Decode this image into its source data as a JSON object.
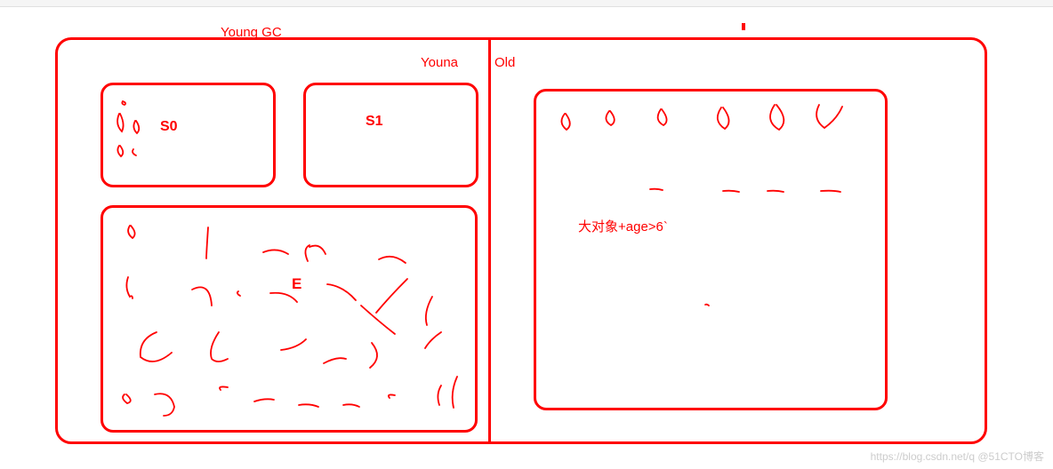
{
  "title_young_gc": "Young GC",
  "section_young": "Youna",
  "section_old": "Old",
  "region_s0": "S0",
  "region_s1": "S1",
  "region_eden": "E",
  "old_rule": "大对象+age>6`",
  "watermark": "https://blog.csdn.net/q @51CTO博客"
}
